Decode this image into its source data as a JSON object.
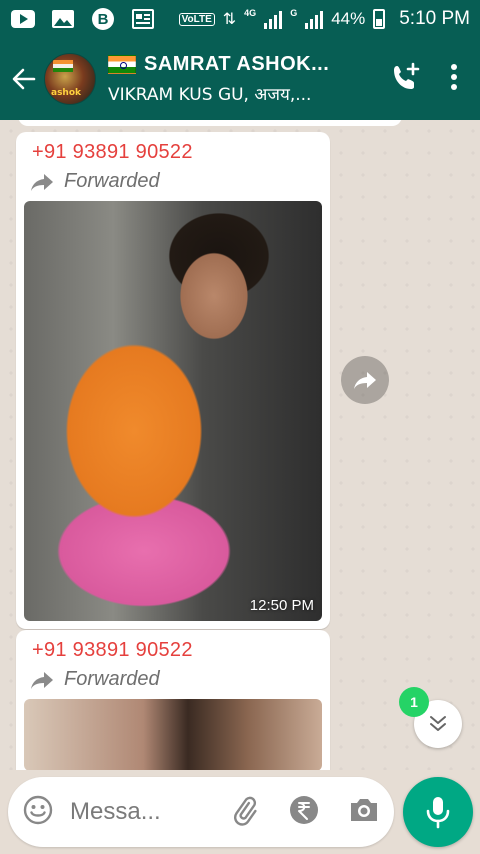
{
  "status_bar": {
    "volte": "VoLTE",
    "network_1": "4G",
    "network_2": "G",
    "battery": "44%",
    "time": "5:10 PM"
  },
  "header": {
    "title": "SAMRAT ASHOK...",
    "subtitle": "VIKRAM  KUS GU, अजय,...",
    "avatar_text": "ashok"
  },
  "messages": [
    {
      "sender": "+91 93891 90522",
      "forwarded_label": "Forwarded",
      "time": "12:50 PM",
      "media": "image"
    },
    {
      "sender": "+91 93891 90522",
      "forwarded_label": "Forwarded",
      "media": "image"
    }
  ],
  "scroll_badge": "1",
  "composer": {
    "placeholder": "Messa..."
  },
  "colors": {
    "header": "#075e54",
    "sender": "#e5403d",
    "accent": "#00a884",
    "badge": "#25d366"
  },
  "icons": [
    "youtube-icon",
    "gallery-icon",
    "bitcoin-icon",
    "news-icon",
    "back-arrow-icon",
    "add-call-icon",
    "more-icon",
    "forward-icon",
    "share-icon",
    "chevron-double-down-icon",
    "emoji-icon",
    "attach-icon",
    "rupee-icon",
    "camera-icon",
    "mic-icon"
  ]
}
